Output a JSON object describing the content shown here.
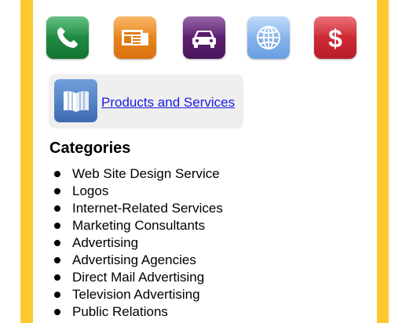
{
  "colors": {
    "side_bar": "#fdc92f",
    "card_background": "#efefef",
    "link": "#1a1ae6"
  },
  "icons": [
    {
      "name": "phone-icon",
      "bg": "#1e8a3e"
    },
    {
      "name": "newspaper-icon",
      "bg": "#ec8a1c"
    },
    {
      "name": "car-icon",
      "bg": "#5a1c6e"
    },
    {
      "name": "globe-icon",
      "bg": "#7fb0ea"
    },
    {
      "name": "dollar-icon",
      "bg": "#d12734"
    }
  ],
  "card": {
    "icon": "book-icon",
    "link_label": "Products and Services"
  },
  "categories": {
    "heading": "Categories",
    "items": [
      "Web Site Design Service",
      "Logos",
      "Internet-Related Services",
      "Marketing Consultants",
      "Advertising",
      "Advertising Agencies",
      "Direct Mail Advertising",
      "Television Advertising",
      "Public Relations"
    ]
  }
}
